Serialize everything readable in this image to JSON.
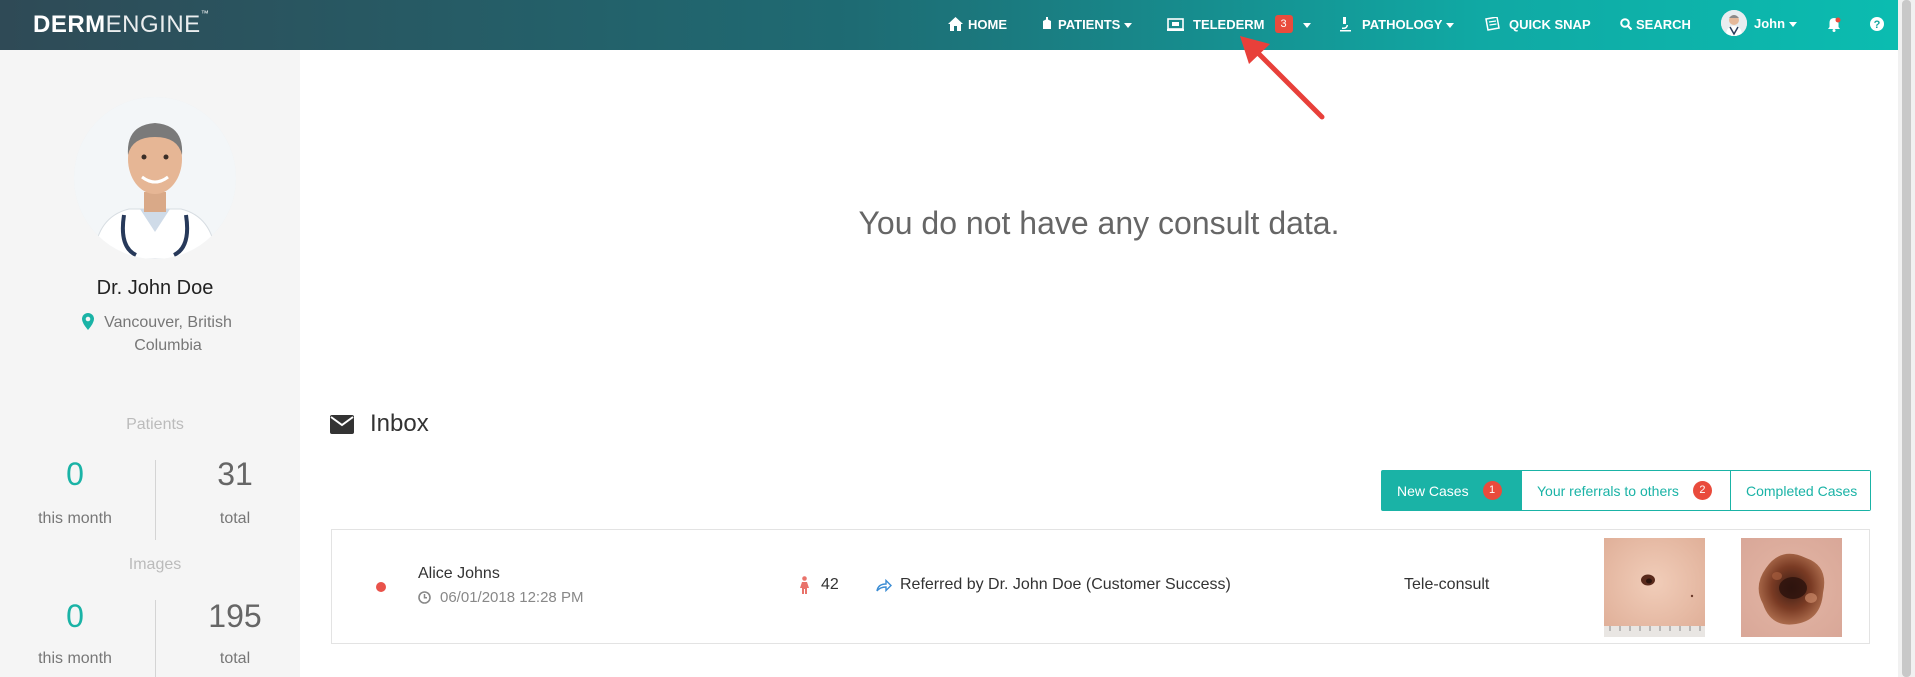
{
  "app": {
    "logo_bold": "DERM",
    "logo_light": "ENGINE",
    "logo_tm": "™"
  },
  "nav": {
    "home": "HOME",
    "patients": "PATIENTS",
    "telederm": "TELEDERM",
    "telederm_badge": "3",
    "pathology": "PATHOLOGY",
    "quick_snap": "QUICK SNAP",
    "search": "SEARCH",
    "user": "John"
  },
  "profile": {
    "name": "Dr. John Doe",
    "location": "Vancouver, British Columbia"
  },
  "stats": {
    "patients_title": "Patients",
    "patients_month": "0",
    "patients_month_label": "this month",
    "patients_total": "31",
    "patients_total_label": "total",
    "images_title": "Images",
    "images_month": "0",
    "images_month_label": "this month",
    "images_total": "195",
    "images_total_label": "total"
  },
  "main": {
    "empty_message": "You do not have any consult data.",
    "inbox_title": "Inbox"
  },
  "tabs": [
    {
      "label": "New Cases",
      "badge": "1"
    },
    {
      "label": "Your referrals to others",
      "badge": "2"
    },
    {
      "label": "Completed Cases"
    }
  ],
  "case": {
    "patient_name": "Alice Johns",
    "date": "06/01/2018 12:28 PM",
    "age": "42",
    "referred": "Referred by Dr. John Doe (Customer Success)",
    "type": "Tele-consult"
  },
  "colors": {
    "accent": "#1ab3a6",
    "badge": "#e94b3c",
    "nav_start": "#2f4a56",
    "nav_end": "#0bbcb0"
  }
}
